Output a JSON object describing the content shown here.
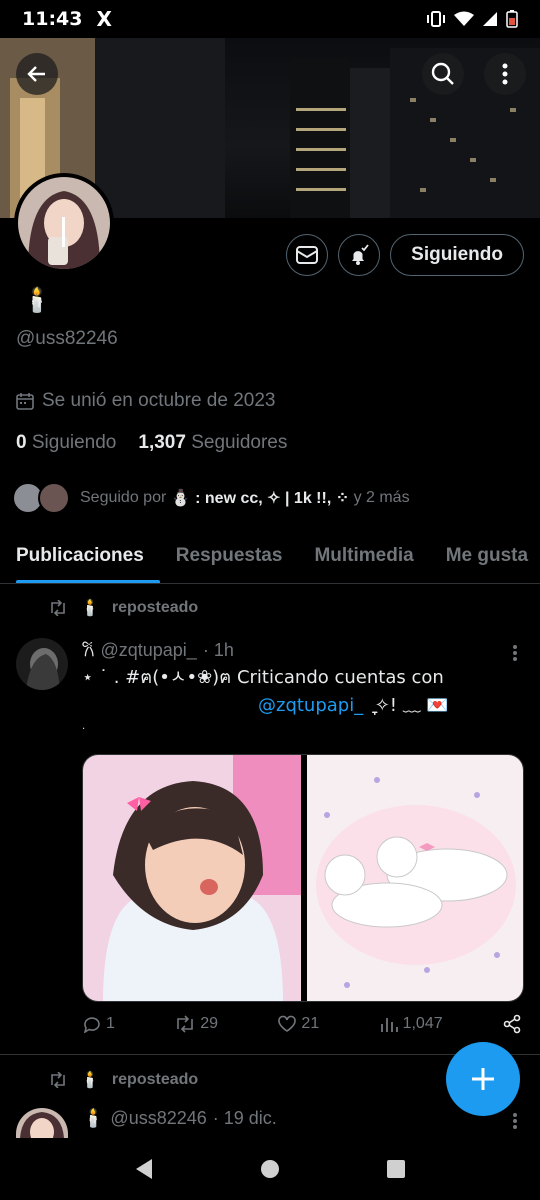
{
  "status_bar": {
    "time": "11:43",
    "app_logo": "X"
  },
  "header": {
    "back_icon": "arrow-left-icon",
    "search_icon": "search-icon",
    "more_icon": "more-vertical-icon"
  },
  "profile": {
    "display_name": "🕯️",
    "handle": "@uss82246",
    "joined": "Se unió en octubre de 2023",
    "following_count": "0",
    "following_label": "Siguiendo",
    "followers_count": "1,307",
    "followers_label": "Seguidores",
    "followed_by_prefix": "Seguido por",
    "followed_by_names": "⛄ : new cc, ✧ | 1k !!, ⁘",
    "followed_by_suffix": "y 2 más",
    "follow_button": "Siguiendo"
  },
  "tabs": [
    {
      "label": "Publicaciones",
      "active": true
    },
    {
      "label": "Respuestas",
      "active": false
    },
    {
      "label": "Multimedia",
      "active": false
    },
    {
      "label": "Me gusta",
      "active": false
    }
  ],
  "posts": [
    {
      "repost_label": "reposteado",
      "repost_user": "🕯️",
      "author_name": "𐙚",
      "author_handle": "@zqtupapi_",
      "time": "· 1h",
      "text_line1": "⋆ ˙ . #ฅ(•ㅅ•❀)ฅ Criticando cuentas con",
      "text_mention": "@zqtupapi_",
      "text_tail": "ִֶָ ✧! ﹏ 💌",
      "text_line3": ".",
      "replies": "1",
      "reposts": "29",
      "likes": "21",
      "views": "1,047"
    },
    {
      "repost_label": "reposteado",
      "repost_user": "🕯️",
      "author_name": "🕯️",
      "author_handle": "@uss82246",
      "time": "· 19 dic."
    }
  ],
  "colors": {
    "accent": "#1d9bf0",
    "muted": "#71767b",
    "border": "#2f3336",
    "text": "#e7e9ea"
  }
}
